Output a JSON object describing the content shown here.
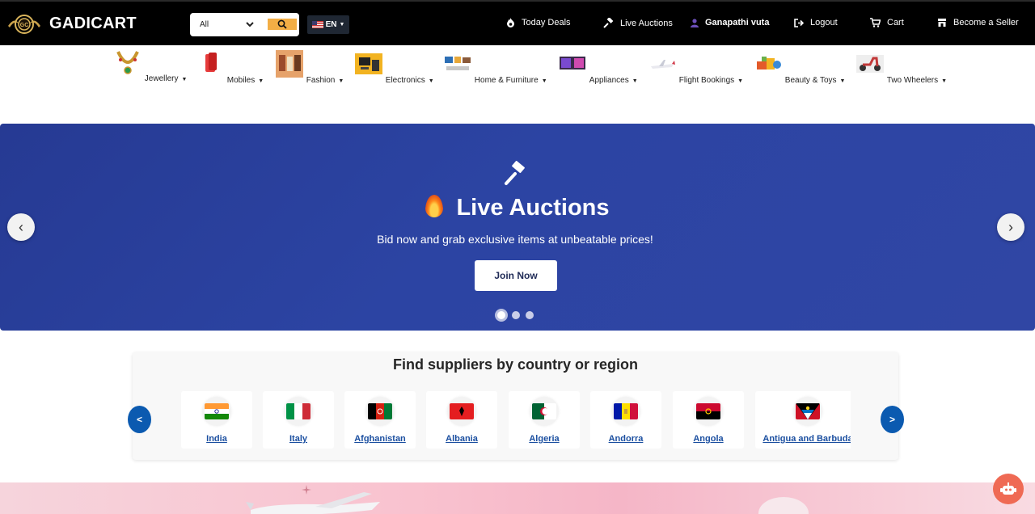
{
  "header": {
    "brand": "GADICART",
    "search": {
      "category": "All"
    },
    "language": "EN",
    "links": {
      "today_deals": "Today Deals",
      "live_auctions": "Live Auctions",
      "user": "Ganapathi vuta",
      "logout": "Logout",
      "cart": "Cart",
      "seller": "Become a Seller"
    }
  },
  "categories": [
    {
      "label": "Jewellery",
      "icon": "jewellery-icon"
    },
    {
      "label": "Mobiles",
      "icon": "mobile-icon"
    },
    {
      "label": "Fashion",
      "icon": "fashion-icon"
    },
    {
      "label": "Electronics",
      "icon": "electronics-icon"
    },
    {
      "label": "Home & Furniture",
      "icon": "home-furniture-icon"
    },
    {
      "label": "Appliances",
      "icon": "appliances-icon"
    },
    {
      "label": "Flight Bookings",
      "icon": "airplane-icon"
    },
    {
      "label": "Beauty & Toys",
      "icon": "toys-icon"
    },
    {
      "label": "Two Wheelers",
      "icon": "scooter-icon"
    }
  ],
  "hero": {
    "title": "Live Auctions",
    "subtitle": "Bid now and grab exclusive items at unbeatable prices!",
    "cta": "Join Now",
    "slides": 3,
    "active_slide": 1,
    "prev": "‹",
    "next": "›"
  },
  "suppliers": {
    "title": "Find suppliers by country or region",
    "prev": "<",
    "next": ">",
    "countries": [
      "India",
      "Italy",
      "Afghanistan",
      "Albania",
      "Algeria",
      "Andorra",
      "Angola",
      "Antigua and Barbuda"
    ]
  },
  "colors": {
    "topbar": "#000000",
    "accent": "#f3ae45",
    "hero": "#2c44a3",
    "link": "#1b4fa0",
    "pager": "#0b5ab0",
    "chat": "#ef6a54"
  }
}
